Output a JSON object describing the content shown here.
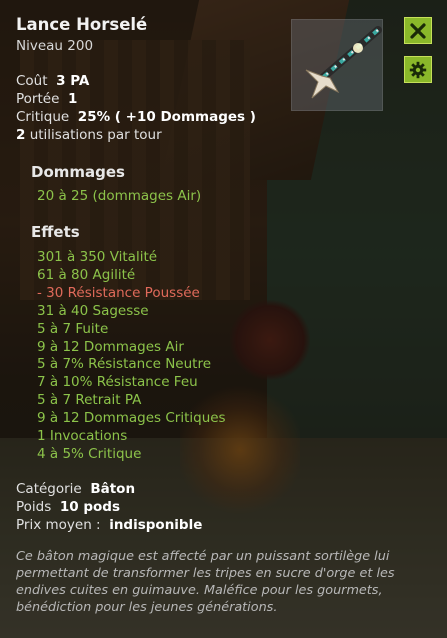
{
  "item": {
    "name": "Lance Horselé",
    "level_label": "Niveau",
    "level": "200"
  },
  "stats": {
    "cost_label": "Coût",
    "cost_value": "3 PA",
    "range_label": "Portée",
    "range_value": "1",
    "crit_label": "Critique",
    "crit_value": "25% ( +10 Dommages )",
    "uses_value": "2",
    "uses_label": "utilisations par tour"
  },
  "damage": {
    "title": "Dommages",
    "line": "20 à 25 (dommages Air)"
  },
  "effects": {
    "title": "Effets",
    "lines": [
      {
        "num": "301 à 350",
        "text": "Vitalité",
        "color": "#8cc34a"
      },
      {
        "num": "61 à 80",
        "text": "Agilité",
        "color": "#8cc34a"
      },
      {
        "num": "- 30",
        "text": "Résistance Poussée",
        "color": "#e06a5a"
      },
      {
        "num": "31 à 40",
        "text": "Sagesse",
        "color": "#8cc34a"
      },
      {
        "num": "5 à 7",
        "text": "Fuite",
        "color": "#8cc34a"
      },
      {
        "num": "9 à 12",
        "text": "Dommages Air",
        "color": "#8cc34a"
      },
      {
        "num": "5 à 7%",
        "text": "Résistance Neutre",
        "color": "#8cc34a"
      },
      {
        "num": "7 à 10%",
        "text": "Résistance Feu",
        "color": "#8cc34a"
      },
      {
        "num": "5 à 7",
        "text": "Retrait PA",
        "color": "#8cc34a"
      },
      {
        "num": "9 à 12",
        "text": "Dommages Critiques",
        "color": "#8cc34a"
      },
      {
        "num": "1",
        "text": "Invocations",
        "color": "#8cc34a"
      },
      {
        "num": "4 à 5%",
        "text": "Critique",
        "color": "#8cc34a"
      }
    ]
  },
  "info": {
    "category_label": "Catégorie",
    "category_value": "Bâton",
    "weight_label": "Poids",
    "weight_value": "10 pods",
    "price_label": "Prix moyen :",
    "price_value": "indisponible"
  },
  "description": "Ce bâton magique est affecté par un puissant sortilège lui permettant de transformer les tripes en sucre d'orge et les endives cuites en guimauve. Maléfice pour les gourmets, bénédiction pour les jeunes générations.",
  "buttons": {
    "close_icon": "close-icon",
    "settings_icon": "gear-icon"
  },
  "colors": {
    "bonus": "#8cc34a",
    "malus": "#e06a5a",
    "button": "#8ab82a"
  }
}
